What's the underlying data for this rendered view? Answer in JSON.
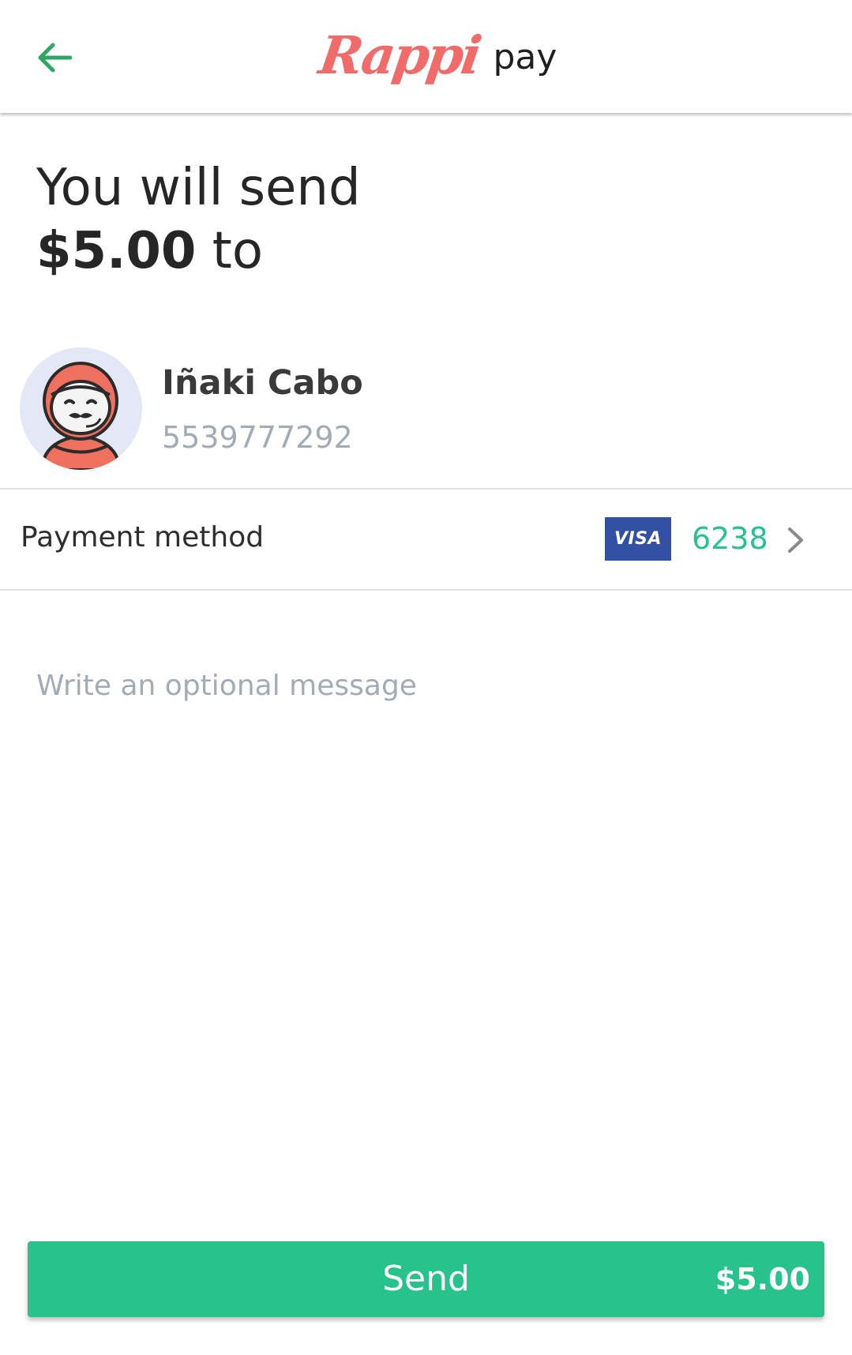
{
  "header": {
    "brand_script": "Rappi",
    "brand_word": "pay",
    "back_icon": "arrow-left-icon",
    "accent_color": "#2fa866",
    "brand_color": "#f26b6b"
  },
  "summary": {
    "line1": "You will send",
    "amount": "$5.00",
    "suffix": " to"
  },
  "recipient": {
    "name": "Iñaki Cabo",
    "phone": "5539777292",
    "avatar_icon": "astronaut-avatar-icon"
  },
  "payment": {
    "label": "Payment method",
    "card_brand": "VISA",
    "card_last4": "6238",
    "chevron_icon": "chevron-right-icon"
  },
  "message": {
    "placeholder": "Write an optional message",
    "value": ""
  },
  "send_button": {
    "label": "Send",
    "amount": "$5.00",
    "color": "#27c38b"
  }
}
